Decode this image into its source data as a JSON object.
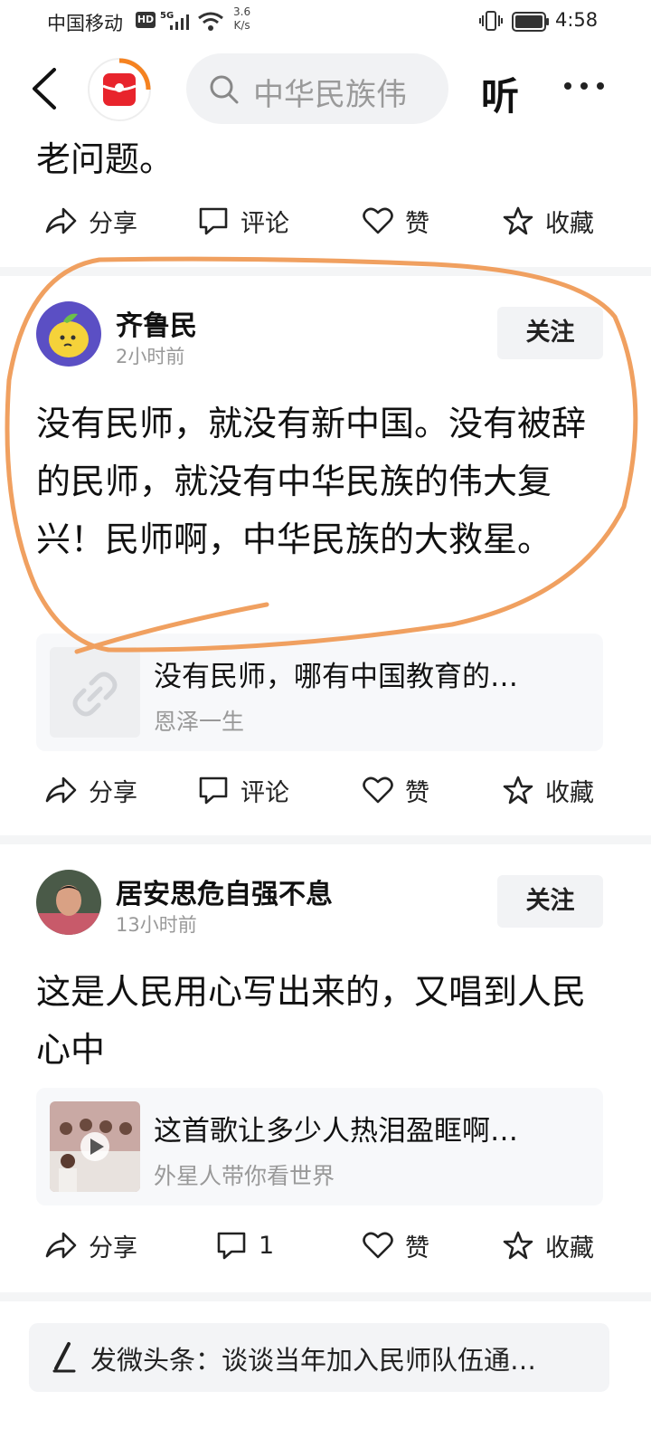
{
  "status_bar": {
    "carrier": "中国移动",
    "hd_badge": "HD",
    "network": "5G",
    "net_speed_value": "3.6",
    "net_speed_unit": "K/s",
    "time": "4:58"
  },
  "nav": {
    "search_query": "中华民族伟",
    "listen_label": "听"
  },
  "previous_post": {
    "text_tail": "老问题。",
    "actions": {
      "share": "分享",
      "comment": "评论",
      "like": "赞",
      "favorite": "收藏"
    }
  },
  "posts": [
    {
      "author": "齐鲁民",
      "time": "2小时前",
      "follow_label": "关注",
      "content": "没有民师，就没有新中国。没有被辞的民师，就没有中华民族的伟大复兴！民师啊，中华民族的大救星。",
      "link": {
        "title": "没有民师，哪有中国教育的…",
        "source": "恩泽一生"
      },
      "actions": {
        "share": "分享",
        "comment": "评论",
        "like": "赞",
        "favorite": "收藏"
      }
    },
    {
      "author": "居安思危自强不息",
      "time": "13小时前",
      "follow_label": "关注",
      "content": "这是人民用心写出来的，又唱到人民心中",
      "link": {
        "title": "这首歌让多少人热泪盈眶啊…",
        "source": "外星人带你看世界"
      },
      "actions": {
        "share": "分享",
        "comment": "1",
        "like": "赞",
        "favorite": "收藏"
      }
    }
  ],
  "compose_bar": {
    "text": "发微头条：谈谈当年加入民师队伍通…"
  },
  "colors": {
    "annotation_stroke": "#F0A060",
    "logo_red": "#E8242C",
    "logo_ring": "#F58220",
    "avatar1_bg": "#5B4FC4",
    "avatar1_fruit": "#F5D23A",
    "card_bg": "#F7F8FA"
  }
}
